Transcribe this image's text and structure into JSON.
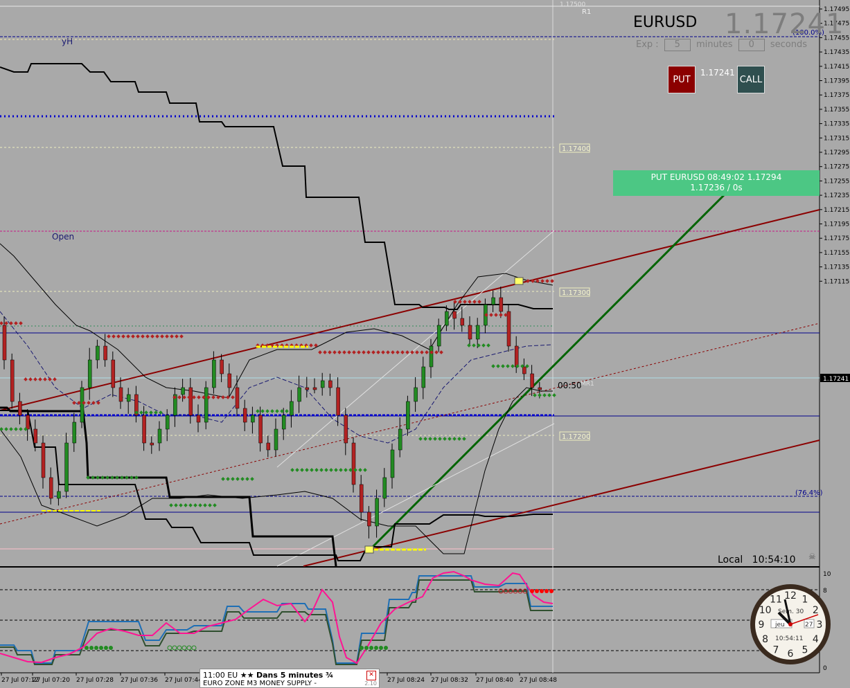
{
  "instrument": {
    "symbol": "EURUSD",
    "price": "1.17241",
    "exp_label": "Exp :",
    "exp_minutes": "5",
    "minutes_label": "minutes",
    "exp_seconds": "0",
    "seconds_label": "seconds",
    "put_label": "PUT",
    "call_label": "CALL",
    "mid_price": "1.17241"
  },
  "trade": {
    "line1": "PUT EURUSD 08:49:02 1.17294",
    "line2": "1.17236 / 0s"
  },
  "chart_labels": {
    "yh": "yH",
    "open": "Open",
    "r1": "R1",
    "fib_100": "(100.0%)",
    "fib_764": "(76.4%)",
    "mr1": "MR1",
    "countdown": "00:50",
    "level_17400": "1.17400",
    "level_17300": "1.17300",
    "level_17200": "1.17200",
    "level_17500": "1.17500"
  },
  "price_axis": [
    "1.17495",
    "1.17475",
    "1.17455",
    "1.17435",
    "1.17415",
    "1.17395",
    "1.17375",
    "1.17355",
    "1.17335",
    "1.17315",
    "1.17295",
    "1.17275",
    "1.17255",
    "1.17235",
    "1.17215",
    "1.17195",
    "1.17175",
    "1.17155",
    "1.17135",
    "1.17115"
  ],
  "current_price_tag": "1.17241",
  "oscillator_axis": [
    "10",
    "8",
    "0"
  ],
  "time_axis": [
    "27 Jul 07:12",
    "27 Jul 07:20",
    "27 Jul 07:28",
    "27 Jul 07:36",
    "27 Jul 07:44",
    "27 Jul 08:24",
    "27 Jul 08:32",
    "27 Jul 08:40",
    "27 Jul 08:48"
  ],
  "local_time": {
    "label": "Local",
    "time": "10:54:10"
  },
  "news": {
    "time": "11:00",
    "region": "EU",
    "stars": "★★",
    "title": "Dans 5 minutes",
    "fraction": "¾",
    "event": "EURO ZONE M3 MONEY SUPPLY -",
    "version": "2.10"
  },
  "clock": {
    "week": "Sem. 30",
    "day": "jeu",
    "date": "27",
    "time": "10:54:11",
    "numbers": [
      "12",
      "1",
      "2",
      "3",
      "4",
      "5",
      "6",
      "7",
      "8",
      "9",
      "10",
      "11"
    ]
  }
}
